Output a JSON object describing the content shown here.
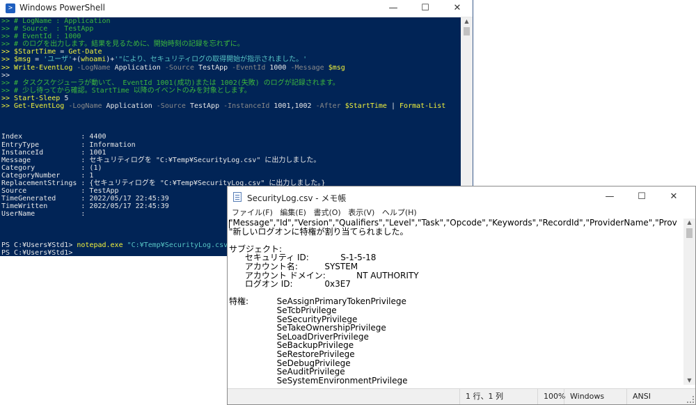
{
  "powershell": {
    "title": "Windows PowerShell",
    "buttons": {
      "minimize": "—",
      "maximize": "☐",
      "close": "✕"
    },
    "lines": [
      [
        {
          "c": "g",
          "t": ">> # LogName : Application"
        }
      ],
      [
        {
          "c": "g",
          "t": ">> # Source  : TestApp"
        }
      ],
      [
        {
          "c": "g",
          "t": ">> # EventId : 1000"
        }
      ],
      [
        {
          "c": "g",
          "t": ">> # のログを出力します。結果を見るために、開始時刻の記録を忘れずに。"
        }
      ],
      [
        {
          "c": "y",
          "t": ">> $StartTime"
        },
        {
          "c": "w",
          "t": " = "
        },
        {
          "c": "y",
          "t": "Get-Date"
        }
      ],
      [
        {
          "c": "y",
          "t": ">> $msg"
        },
        {
          "c": "w",
          "t": " = "
        },
        {
          "c": "cy",
          "t": "'ユーザ'"
        },
        {
          "c": "w",
          "t": "+("
        },
        {
          "c": "y",
          "t": "whoami"
        },
        {
          "c": "w",
          "t": ")+"
        },
        {
          "c": "cy",
          "t": "'\"により、セキュリティログの取得開始が指示されました。'"
        }
      ],
      [
        {
          "c": "y",
          "t": ">> Write-EventLog"
        },
        {
          "c": "dg",
          "t": " -LogName "
        },
        {
          "c": "w",
          "t": "Application"
        },
        {
          "c": "dg",
          "t": " -Source "
        },
        {
          "c": "w",
          "t": "TestApp"
        },
        {
          "c": "dg",
          "t": " -EventId "
        },
        {
          "c": "w",
          "t": "1000"
        },
        {
          "c": "dg",
          "t": " -Message "
        },
        {
          "c": "y",
          "t": "$msg"
        }
      ],
      [
        {
          "c": "w",
          "t": ">>"
        }
      ],
      [
        {
          "c": "g",
          "t": ">> # タスクスケジューラが動いて、 EventId 1001(成功)または 1002(失敗) のログが記録されます。"
        }
      ],
      [
        {
          "c": "g",
          "t": ">> # 少し待ってから確認。StartTime 以降のイベントのみを対象とします。"
        }
      ],
      [
        {
          "c": "y",
          "t": ">> Start-Sleep"
        },
        {
          "c": "w",
          "t": " 5"
        }
      ],
      [
        {
          "c": "y",
          "t": ">> Get-EventLog"
        },
        {
          "c": "dg",
          "t": " -LogName "
        },
        {
          "c": "w",
          "t": "Application"
        },
        {
          "c": "dg",
          "t": " -Source "
        },
        {
          "c": "w",
          "t": "TestApp"
        },
        {
          "c": "dg",
          "t": " -InstanceId "
        },
        {
          "c": "w",
          "t": "1001,1002"
        },
        {
          "c": "dg",
          "t": " -After "
        },
        {
          "c": "y",
          "t": "$StartTime"
        },
        {
          "c": "w",
          "t": " | "
        },
        {
          "c": "y",
          "t": "Format-List"
        }
      ],
      [],
      [],
      [],
      [
        {
          "c": "w",
          "t": "Index              : 4400"
        }
      ],
      [
        {
          "c": "w",
          "t": "EntryType          : Information"
        }
      ],
      [
        {
          "c": "w",
          "t": "InstanceId         : 1001"
        }
      ],
      [
        {
          "c": "w",
          "t": "Message            : セキュリティログを \"C:¥Temp¥SecurityLog.csv\" に出力しました。"
        }
      ],
      [
        {
          "c": "w",
          "t": "Category           : (1)"
        }
      ],
      [
        {
          "c": "w",
          "t": "CategoryNumber     : 1"
        }
      ],
      [
        {
          "c": "w",
          "t": "ReplacementStrings : {セキュリティログを \"C:¥Temp¥SecurityLog.csv\" に出力しました。}"
        }
      ],
      [
        {
          "c": "w",
          "t": "Source             : TestApp"
        }
      ],
      [
        {
          "c": "w",
          "t": "TimeGenerated      : 2022/05/17 22:45:39"
        }
      ],
      [
        {
          "c": "w",
          "t": "TimeWritten        : 2022/05/17 22:45:39"
        }
      ],
      [
        {
          "c": "w",
          "t": "UserName           :"
        }
      ],
      [],
      [],
      [],
      [
        {
          "c": "w",
          "t": "PS C:¥Users¥Std1> "
        },
        {
          "c": "y",
          "t": "notepad.exe"
        },
        {
          "c": "cy",
          "t": " \"C:¥Temp¥SecurityLog.csv\""
        }
      ],
      [
        {
          "c": "w",
          "t": "PS C:¥Users¥Std1>"
        }
      ]
    ]
  },
  "notepad": {
    "title": "SecurityLog.csv - メモ帳",
    "buttons": {
      "minimize": "—",
      "maximize": "☐",
      "close": "✕"
    },
    "menu": [
      "ファイル(F)",
      "編集(E)",
      "書式(O)",
      "表示(V)",
      "ヘルプ(H)"
    ],
    "lines": [
      "\"Message\",\"Id\",\"Version\",\"Qualifiers\",\"Level\",\"Task\",\"Opcode\",\"Keywords\",\"RecordId\",\"ProviderName\",\"Prov",
      "\"新しいログオンに特権が割り当てられました。",
      "",
      "サブジェクト:",
      "\tセキュリティ ID:\t\tS-1-5-18",
      "\tアカウント名:\t\tSYSTEM",
      "\tアカウント ドメイン:\t\tNT AUTHORITY",
      "\tログオン ID:\t\t0x3E7",
      "",
      "特権:\t\tSeAssignPrimaryTokenPrivilege",
      "\t\t\tSeTcbPrivilege",
      "\t\t\tSeSecurityPrivilege",
      "\t\t\tSeTakeOwnershipPrivilege",
      "\t\t\tSeLoadDriverPrivilege",
      "\t\t\tSeBackupPrivilege",
      "\t\t\tSeRestorePrivilege",
      "\t\t\tSeDebugPrivilege",
      "\t\t\tSeAuditPrivilege",
      "\t\t\tSeSystemEnvironmentPrivilege"
    ],
    "status": {
      "position": "1 行、1 列",
      "zoom": "100%",
      "line_ending": "Windows (CRLF)",
      "encoding": "ANSI"
    }
  }
}
